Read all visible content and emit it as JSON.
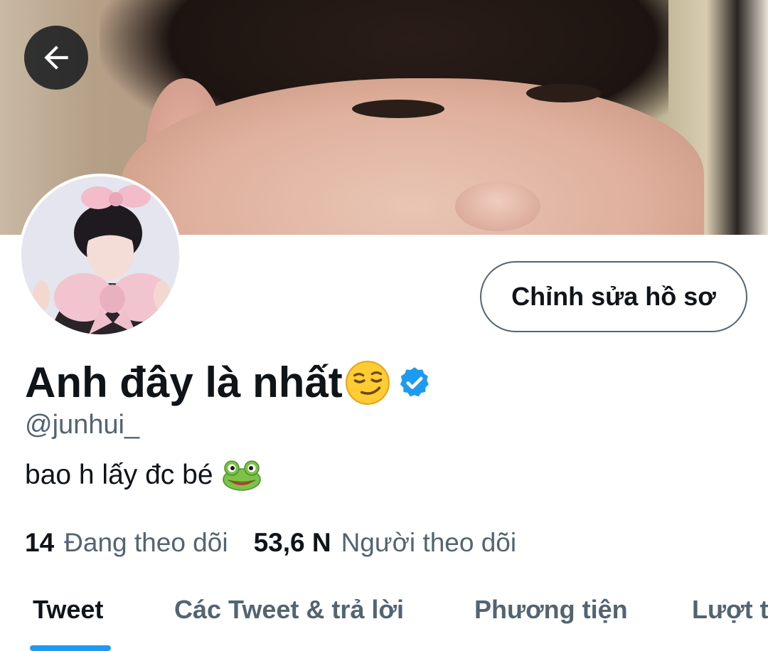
{
  "profile": {
    "display_name": "Anh đây là nhất",
    "handle": "@junhui_",
    "bio": "bao h lấy đc bé",
    "verified": true,
    "name_emoji_icon": "smirking-face-emoji",
    "bio_emoji_icon": "frog-face-emoji"
  },
  "actions": {
    "edit_profile_label": "Chỉnh sửa hồ sơ",
    "back_icon": "arrow-left-icon"
  },
  "stats": {
    "following_count": "14",
    "following_label": "Đang theo dõi",
    "followers_count": "53,6 N",
    "followers_label": "Người theo dõi"
  },
  "tabs": [
    {
      "label": "Tweet",
      "active": true
    },
    {
      "label": "Các Tweet & trả lời",
      "active": false
    },
    {
      "label": "Phương tiện",
      "active": false
    },
    {
      "label": "Lượt thích",
      "active": false
    }
  ],
  "colors": {
    "accent": "#1d9bf0",
    "text_primary": "#0f1419",
    "text_secondary": "#536471"
  }
}
